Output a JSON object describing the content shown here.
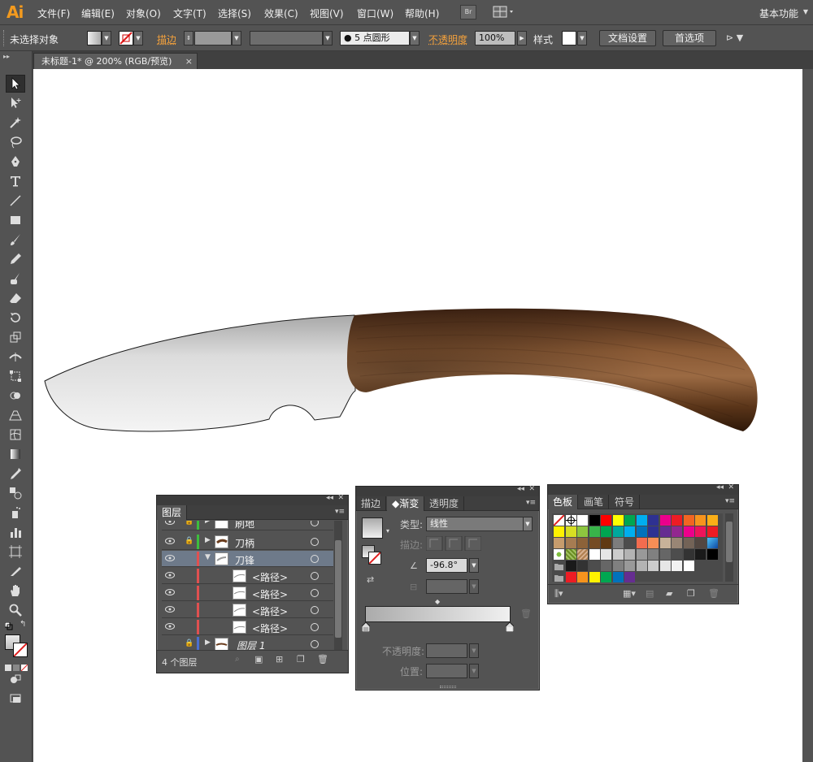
{
  "app": {
    "logo": "Ai"
  },
  "menubar": {
    "items": [
      "文件(F)",
      "编辑(E)",
      "对象(O)",
      "文字(T)",
      "选择(S)",
      "效果(C)",
      "视图(V)",
      "窗口(W)",
      "帮助(H)"
    ],
    "bridge_label": "Br",
    "workspace": "基本功能"
  },
  "control_bar": {
    "selection_status": "未选择对象",
    "stroke_label": "描边",
    "brush_value": "5 点圆形",
    "opacity_label": "不透明度",
    "opacity_value": "100%",
    "style_label": "样式",
    "doc_setup_button": "文档设置",
    "preferences_button": "首选项"
  },
  "document_tab": {
    "title": "未标题-1* @ 200% (RGB/预览)",
    "close": "×"
  },
  "layers_panel": {
    "tab_label": "图层",
    "rows": [
      {
        "name": "刷地"
      },
      {
        "name": "刀柄"
      },
      {
        "name": "刀锋"
      },
      {
        "name": "<路径>"
      },
      {
        "name": "<路径>"
      },
      {
        "name": "<路径>"
      },
      {
        "name": "<路径>"
      },
      {
        "name": "图层 1"
      }
    ],
    "footer_count": "4 个图层"
  },
  "gradient_panel": {
    "tabs": [
      "描边",
      "渐变",
      "透明度"
    ],
    "type_label": "类型:",
    "type_value": "线性",
    "stroke_label": "描边:",
    "angle_value": "-96.8°",
    "opacity_label": "不透明度:",
    "location_label": "位置:"
  },
  "swatches_panel": {
    "tabs": [
      "色板",
      "画笔",
      "符号"
    ]
  },
  "colors": {
    "accent_orange": "#f39a1e",
    "blade_light": "#f2f2f2",
    "blade_dark": "#c9c9c9",
    "handle_dark": "#3d2212",
    "handle_mid": "#8a5a35"
  }
}
